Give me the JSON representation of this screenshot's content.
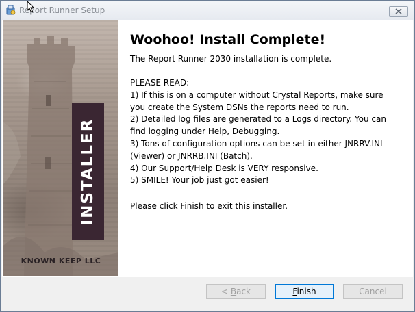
{
  "window": {
    "title": "Report Runner Setup"
  },
  "banner": {
    "vertical_label": "INSTALLER",
    "company": "KNOWN KEEP LLC"
  },
  "main": {
    "heading": "Woohoo! Install Complete!",
    "intro": "The Report Runner 2030 installation is complete.",
    "please_read_lines": [
      "PLEASE READ:",
      "1) If this is on a computer without Crystal Reports, make sure",
      "you create the System DSNs the reports need to run.",
      "2) Detailed log files are generated to a Logs directory. You can",
      "find logging under Help, Debugging.",
      "3) Tons of configuration options can be set in either JNRRV.INI",
      "(Viewer) or JNRRB.INI (Batch).",
      "4) Our Support/Help Desk is VERY responsive.",
      "5) SMILE! Your job just got easier!"
    ],
    "outro": "Please click Finish to exit this installer."
  },
  "buttons": {
    "back_prefix": "< ",
    "back_accel": "B",
    "back_rest": "ack",
    "finish_accel": "F",
    "finish_rest": "inish",
    "cancel": "Cancel"
  },
  "colors": {
    "banner_label_bg": "#3a2632",
    "focus_border": "#0078d7"
  }
}
